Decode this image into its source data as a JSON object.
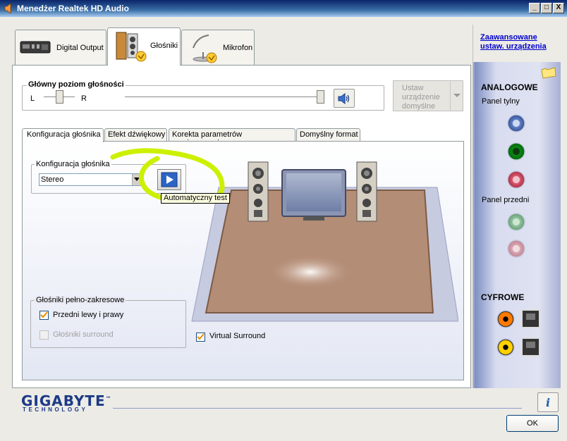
{
  "window": {
    "title": "Menedżer Realtek HD Audio",
    "min_label": "_",
    "max_label": "□",
    "close_label": "X"
  },
  "device_tabs": [
    {
      "label": "Digital Output"
    },
    {
      "label": "Głośniki"
    },
    {
      "label": "Mikrofon"
    }
  ],
  "advanced_link": "Zaawansowane\nustaw. urządzenia",
  "volume": {
    "title": "Główny poziom głośności",
    "left_label": "L",
    "right_label": "R",
    "balance": 0.5,
    "level": 1.0
  },
  "set_default": {
    "label": "Ustaw\nurządzenie\ndomyślne"
  },
  "sub_tabs": [
    {
      "label": "Konfiguracja głośnika"
    },
    {
      "label": "Efekt dźwiękowy"
    },
    {
      "label": "Korekta parametrów pomieszczenia"
    },
    {
      "label": "Domyślny format"
    }
  ],
  "speaker_config": {
    "group_title": "Konfiguracja głośnika",
    "selected": "Stereo",
    "tooltip": "Automatyczny test"
  },
  "fullrange": {
    "group_title": "Głośniki pełno-zakresowe",
    "front_label": "Przedni lewy i prawy",
    "front_checked": true,
    "surround_label": "Głośniki surround",
    "surround_checked": false
  },
  "virtual_surround": {
    "label": "Virtual Surround",
    "checked": true
  },
  "right_panel": {
    "analog_title": "ANALOGOWE",
    "rear_title": "Panel tylny",
    "front_title": "Panel przedni",
    "digital_title": "CYFROWE"
  },
  "brand": {
    "name": "GIGABYTE",
    "sub": "TECHNOLOGY",
    "tm": "™"
  },
  "ok_label": "OK",
  "info_label": "i",
  "colors": {
    "title_bar": "#0a246a",
    "annotation": "#ccf000",
    "jack_blue": "#5a7fc6",
    "jack_green": "#0a8a12",
    "jack_pink": "#d9556b",
    "jack_orange": "#ff7a00",
    "jack_yellow": "#ffd200"
  }
}
